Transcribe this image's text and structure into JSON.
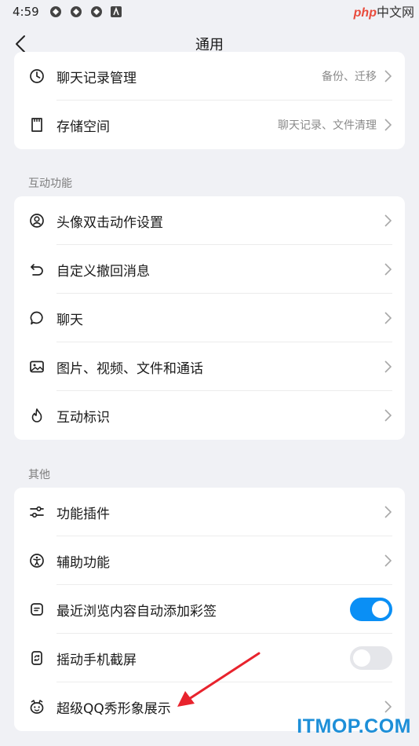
{
  "status_bar": {
    "time": "4:59"
  },
  "watermark_top": {
    "php": "php",
    "text": "中文网"
  },
  "nav": {
    "title": "通用"
  },
  "card1": [
    {
      "label": "聊天记录管理",
      "value": "备份、迁移",
      "icon": "clock-icon"
    },
    {
      "label": "存储空间",
      "value": "聊天记录、文件清理",
      "icon": "storage-icon"
    }
  ],
  "section_interactive": {
    "title": "互动功能"
  },
  "card2": [
    {
      "label": "头像双击动作设置",
      "icon": "avatar-icon"
    },
    {
      "label": "自定义撤回消息",
      "icon": "undo-icon"
    },
    {
      "label": "聊天",
      "icon": "chat-bubble-icon"
    },
    {
      "label": "图片、视频、文件和通话",
      "icon": "image-icon"
    },
    {
      "label": "互动标识",
      "icon": "flame-icon"
    }
  ],
  "section_other": {
    "title": "其他"
  },
  "card3": [
    {
      "label": "功能插件",
      "icon": "sliders-icon"
    },
    {
      "label": "辅助功能",
      "icon": "accessibility-icon"
    },
    {
      "label": "最近浏览内容自动添加彩签",
      "icon": "note-icon",
      "toggle": true
    },
    {
      "label": "摇动手机截屏",
      "icon": "shake-phone-icon",
      "toggle": false
    },
    {
      "label": "超级QQ秀形象展示",
      "icon": "qq-show-icon"
    }
  ],
  "watermark_bottom": {
    "text": "ITMOP.COM"
  },
  "colors": {
    "accent": "#0a8ff5",
    "background": "#f0f1f5",
    "annotation_arrow": "#e8232d"
  }
}
